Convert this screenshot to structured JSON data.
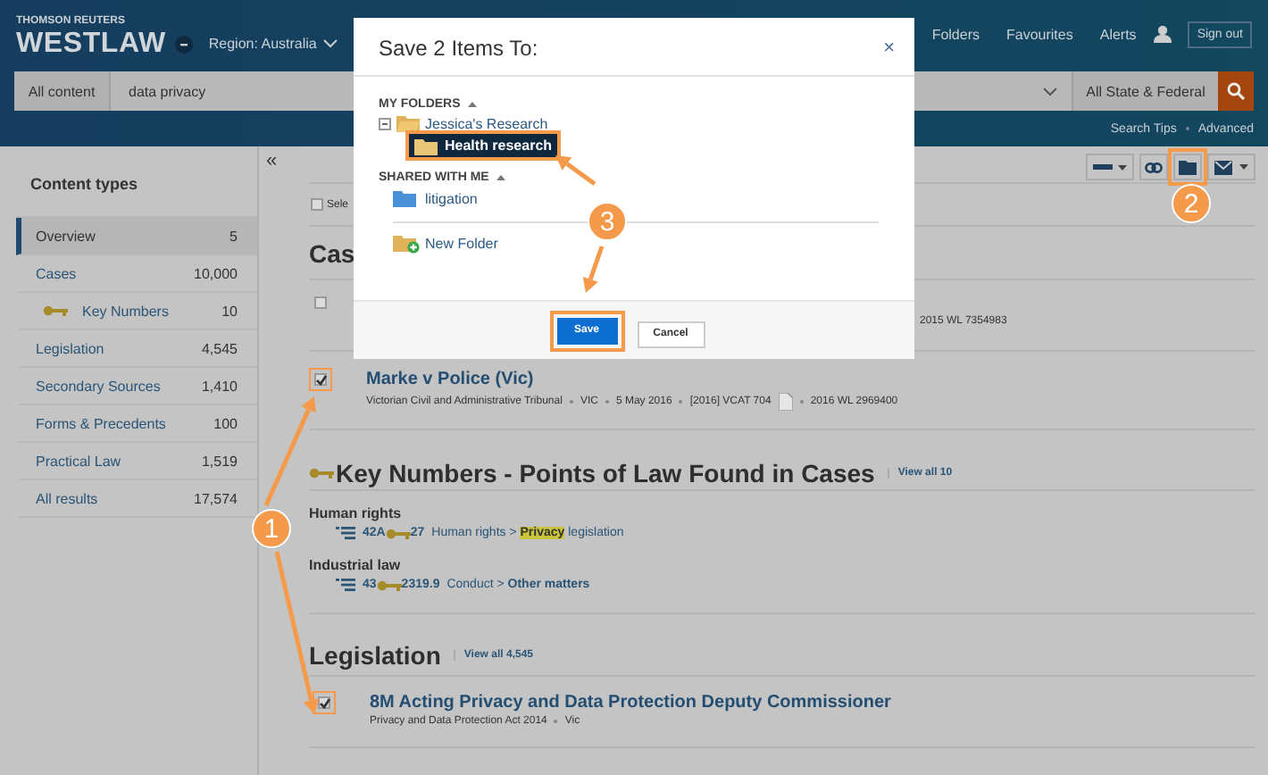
{
  "header": {
    "brand_small": "THOMSON REUTERS",
    "brand": "WESTLAW",
    "region": "Region: Australia",
    "nav": [
      "Folders",
      "Favourites",
      "Alerts"
    ],
    "sign_out": "Sign out"
  },
  "search": {
    "scope": "All content",
    "value": "data privacy",
    "jurisdiction": "All State & Federal"
  },
  "search_links": [
    "Search Tips",
    "Advanced"
  ],
  "sidebar": {
    "collapse": "«",
    "title": "Content types",
    "items": [
      {
        "label": "Overview",
        "count": "5",
        "selected": true,
        "kind": "plain"
      },
      {
        "label": "Cases",
        "count": "10,000",
        "selected": false,
        "kind": "plain"
      },
      {
        "label": "Key Numbers",
        "count": "10",
        "selected": false,
        "kind": "key"
      },
      {
        "label": "Legislation",
        "count": "4,545",
        "selected": false,
        "kind": "plain"
      },
      {
        "label": "Secondary Sources",
        "count": "1,410",
        "selected": false,
        "kind": "plain"
      },
      {
        "label": "Forms & Precedents",
        "count": "100",
        "selected": false,
        "kind": "plain"
      },
      {
        "label": "Practical Law",
        "count": "1,519",
        "selected": false,
        "kind": "plain"
      },
      {
        "label": "All results",
        "count": "17,574",
        "selected": false,
        "kind": "plain"
      }
    ]
  },
  "select_all": {
    "label": "Sele",
    "checked": false
  },
  "cases": {
    "title": "Cas",
    "results": [
      {
        "checked": false,
        "meta": [
          {
            "text": "2015 WL 7354983",
            "doc": false
          }
        ]
      },
      {
        "checked": true,
        "title": "Marke v Police (Vic)",
        "meta": [
          {
            "text": "Victorian Civil and Administrative Tribunal",
            "doc": false
          },
          {
            "text": "VIC",
            "doc": false
          },
          {
            "text": "5 May 2016",
            "doc": false
          },
          {
            "text": "[2016] VCAT 704",
            "doc": true
          },
          {
            "text": "2016 WL 2969400",
            "doc": false
          }
        ]
      }
    ]
  },
  "key_numbers": {
    "title": "Key Numbers - Points of Law Found in Cases",
    "view_all": "View all 10",
    "groups": [
      {
        "heading": "Human rights",
        "code_a": "42A",
        "code_b": "27",
        "topic": [
          {
            "text": "Human rights > ",
            "kind": "plain"
          },
          {
            "text": "Privacy",
            "kind": "hit"
          },
          {
            "text": " legislation",
            "kind": "plain"
          }
        ]
      },
      {
        "heading": "Industrial law",
        "code_a": "43",
        "code_b": "2319.9",
        "topic": [
          {
            "text": "Conduct > ",
            "kind": "plain"
          },
          {
            "text": "Other matters",
            "kind": "bold"
          }
        ]
      }
    ]
  },
  "legislation": {
    "title": "Legislation",
    "view_all": "View all 4,545",
    "results": [
      {
        "checked": true,
        "title": "8M Acting Privacy and Data Protection Deputy Commissioner",
        "meta": [
          {
            "text": "Privacy and Data Protection Act 2014",
            "doc": false
          },
          {
            "text": "Vic",
            "doc": false
          }
        ]
      }
    ]
  },
  "dialog": {
    "title": "Save 2 Items To:",
    "close": "×",
    "my_folders": "MY FOLDERS",
    "folders": [
      {
        "label": "Jessica's Research",
        "expanded": true,
        "selected": false,
        "children": [
          {
            "label": "Health research",
            "selected": true
          }
        ]
      }
    ],
    "shared_title": "SHARED WITH ME",
    "shared_folders": [
      {
        "label": "litigation",
        "selected": false
      }
    ],
    "new_folder": "New Folder",
    "buttons": [
      {
        "label": "Save",
        "kind": "primary"
      },
      {
        "label": "Cancel",
        "kind": "secondary"
      }
    ]
  },
  "callouts": [
    "1",
    "2",
    "3"
  ]
}
